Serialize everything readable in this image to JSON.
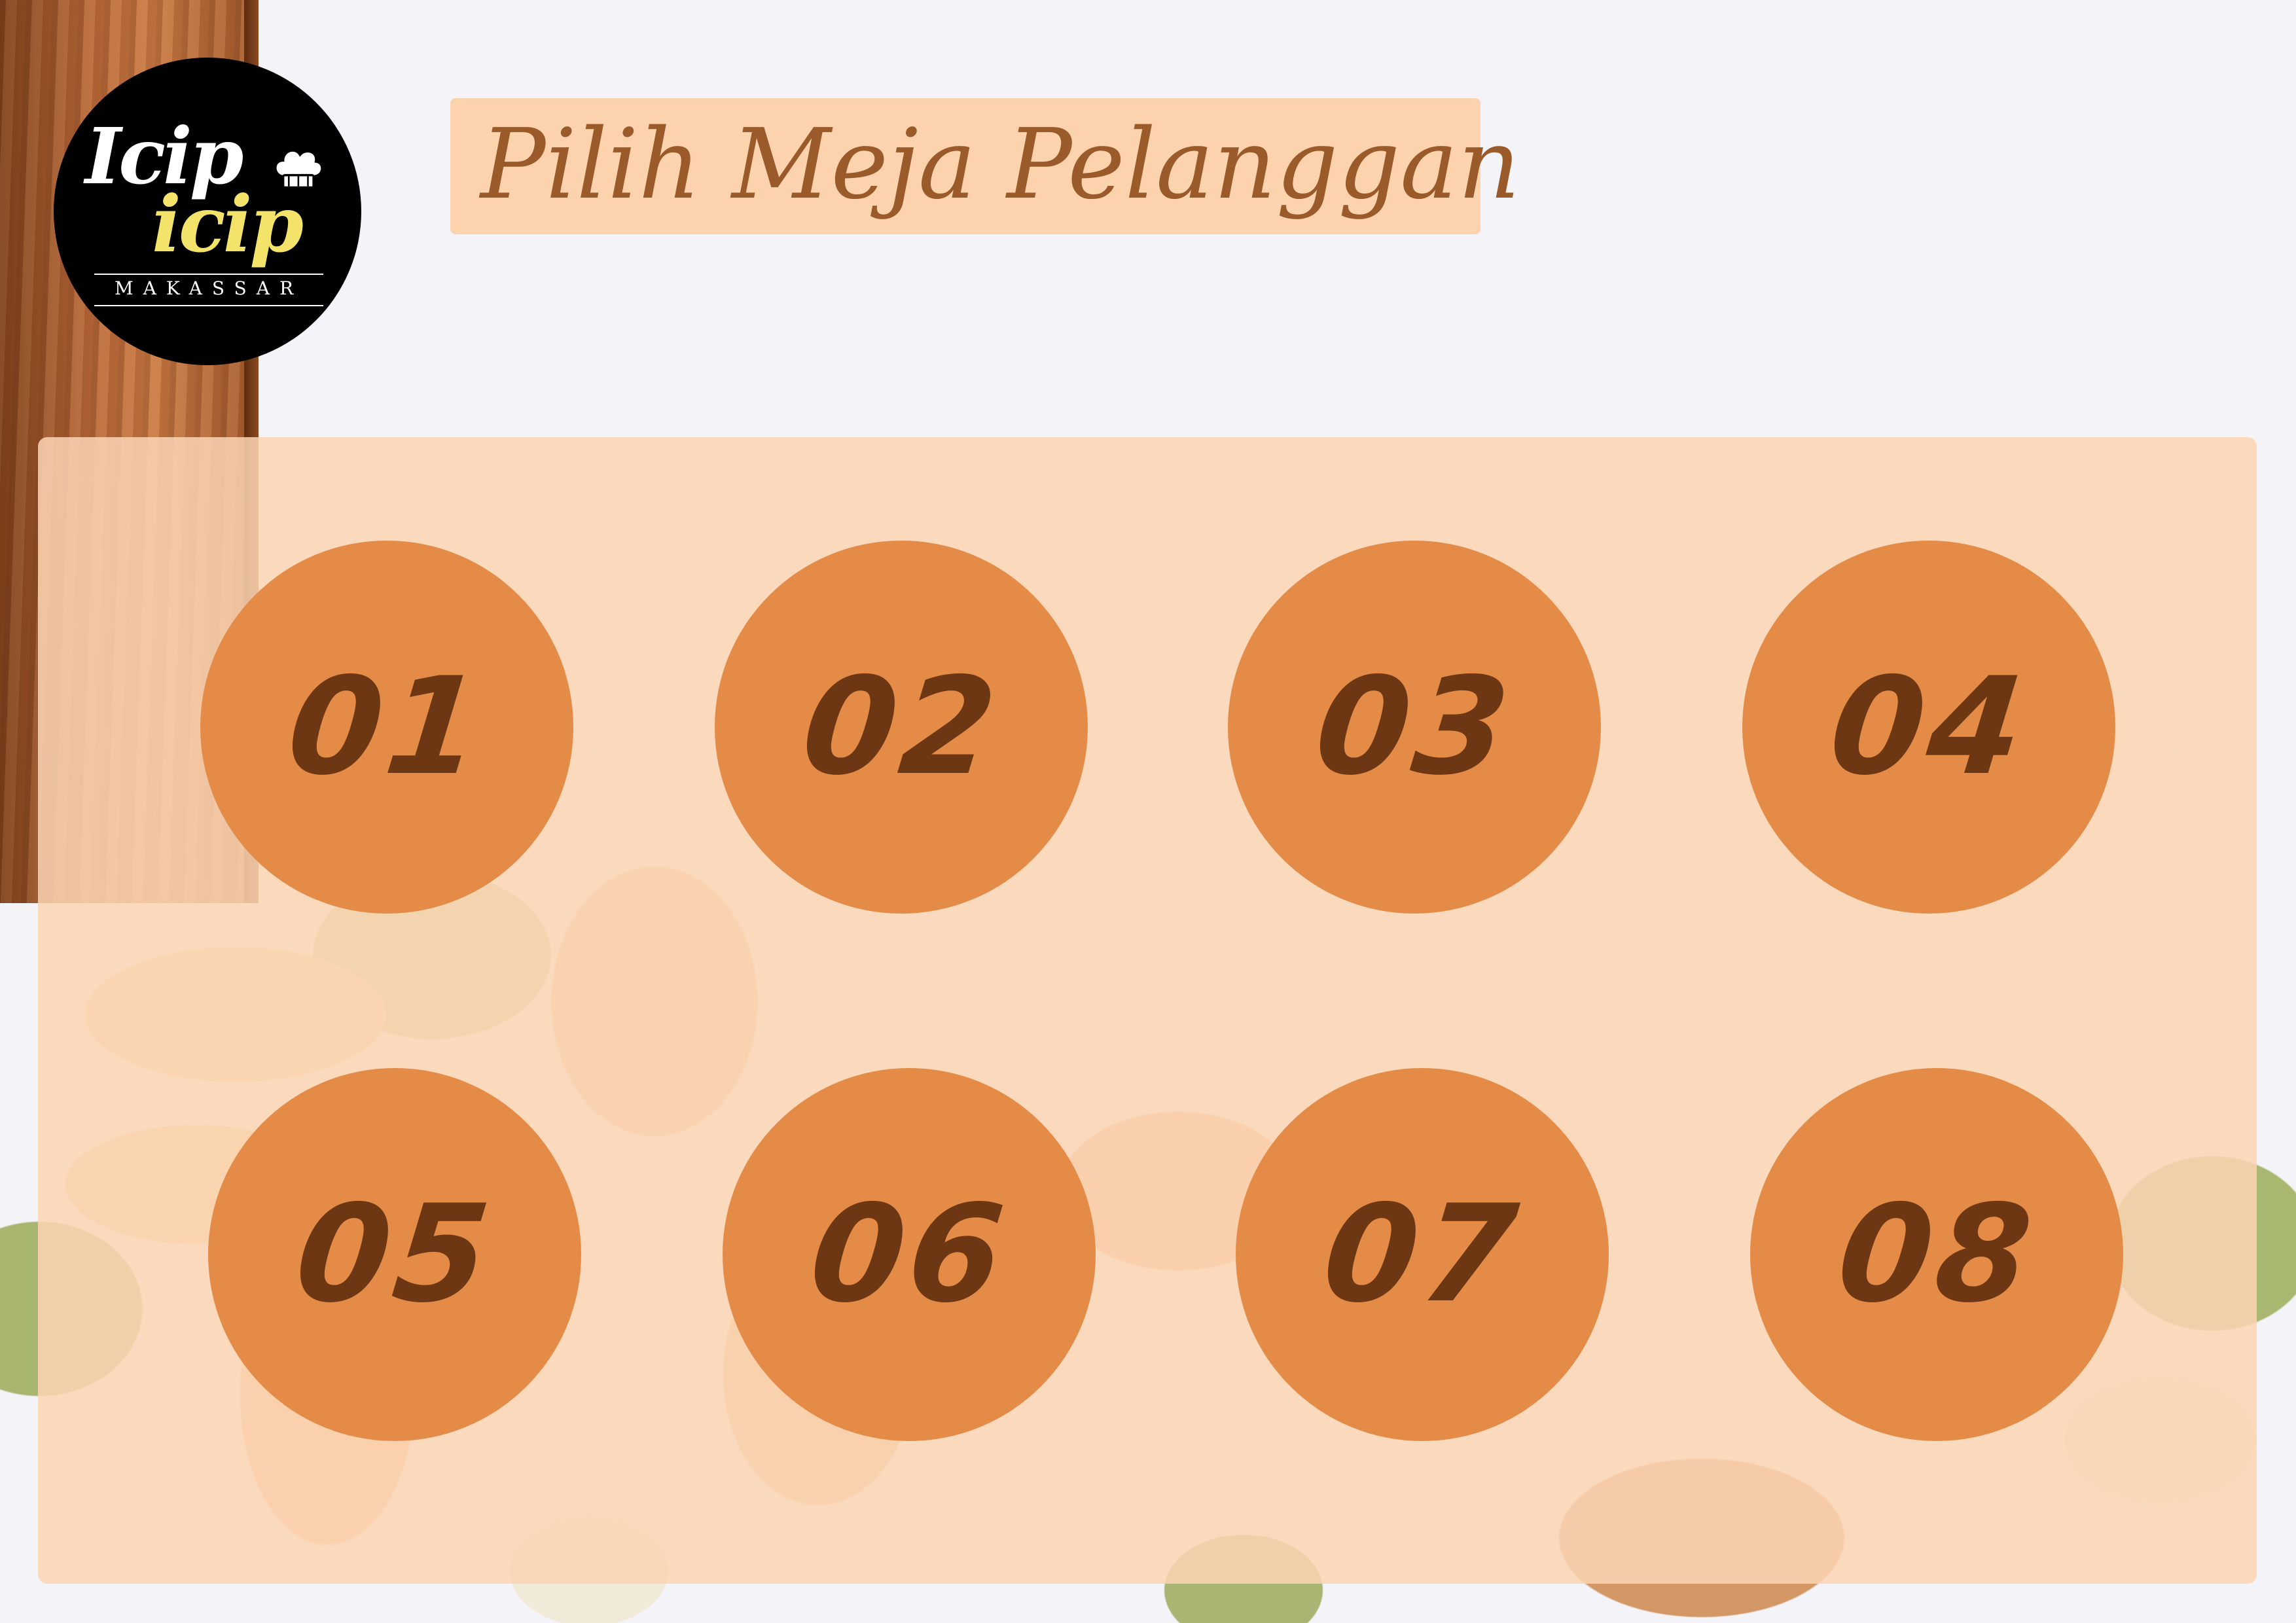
{
  "brand": {
    "logo_text_top": "Icip",
    "logo_text_bottom": "icip",
    "logo_city": "MAKASSAR",
    "icon": "chef-hat-icon",
    "colors": {
      "logo_bg": "#000000",
      "logo_text_top": "#ffffff",
      "logo_text_bottom": "#f3e36a"
    }
  },
  "header": {
    "title": "Pilih Meja Pelanggan",
    "colors": {
      "background": "#fdd3ae",
      "text": "#9a5a2a"
    }
  },
  "tables": {
    "items": [
      {
        "label": "01"
      },
      {
        "label": "02"
      },
      {
        "label": "03"
      },
      {
        "label": "04"
      },
      {
        "label": "05"
      },
      {
        "label": "06"
      },
      {
        "label": "07"
      },
      {
        "label": "08"
      }
    ],
    "colors": {
      "panel": "#fcd4b2",
      "button": "#e58b48",
      "label": "#6c3712"
    }
  }
}
